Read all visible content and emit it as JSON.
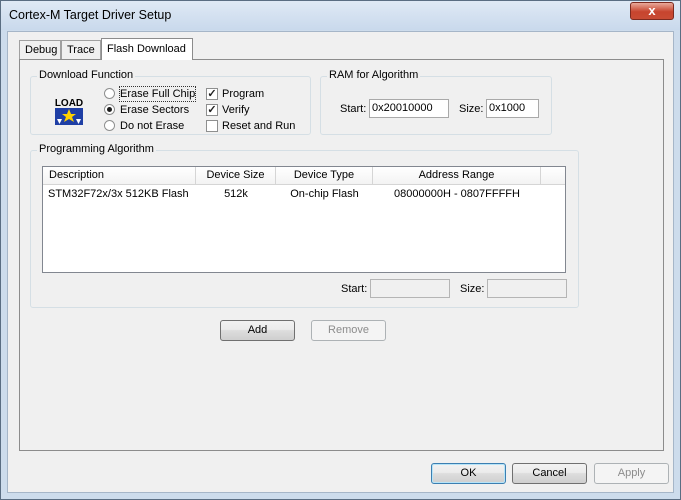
{
  "window": {
    "title": "Cortex-M Target Driver Setup",
    "close_glyph": "x"
  },
  "tabs": [
    {
      "label": "Debug",
      "active": false
    },
    {
      "label": "Trace",
      "active": false
    },
    {
      "label": "Flash Download",
      "active": true
    }
  ],
  "download_function": {
    "group_label": "Download Function",
    "icon": "load-icon",
    "icon_text": "LOAD",
    "options": [
      {
        "label": "Erase Full Chip",
        "selected": false
      },
      {
        "label": "Erase Sectors",
        "selected": true
      },
      {
        "label": "Do not Erase",
        "selected": false
      }
    ],
    "checks": [
      {
        "label": "Program",
        "checked": true
      },
      {
        "label": "Verify",
        "checked": true
      },
      {
        "label": "Reset and Run",
        "checked": false
      }
    ]
  },
  "ram": {
    "group_label": "RAM for Algorithm",
    "start_label": "Start:",
    "start_value": "0x20010000",
    "size_label": "Size:",
    "size_value": "0x1000"
  },
  "programming_algorithm": {
    "group_label": "Programming Algorithm",
    "columns": [
      "Description",
      "Device Size",
      "Device Type",
      "Address Range"
    ],
    "rows": [
      [
        "STM32F72x/3x 512KB Flash",
        "512k",
        "On-chip Flash",
        "08000000H - 0807FFFFH"
      ]
    ],
    "start_label": "Start:",
    "start_value": "",
    "size_label": "Size:",
    "size_value": ""
  },
  "buttons": {
    "add": "Add",
    "remove": "Remove",
    "ok": "OK",
    "cancel": "Cancel",
    "apply": "Apply"
  },
  "colors": {
    "title_bar": "#cddcec",
    "close_button": "#c7442e",
    "dialog_bg": "#f0f0f0"
  }
}
